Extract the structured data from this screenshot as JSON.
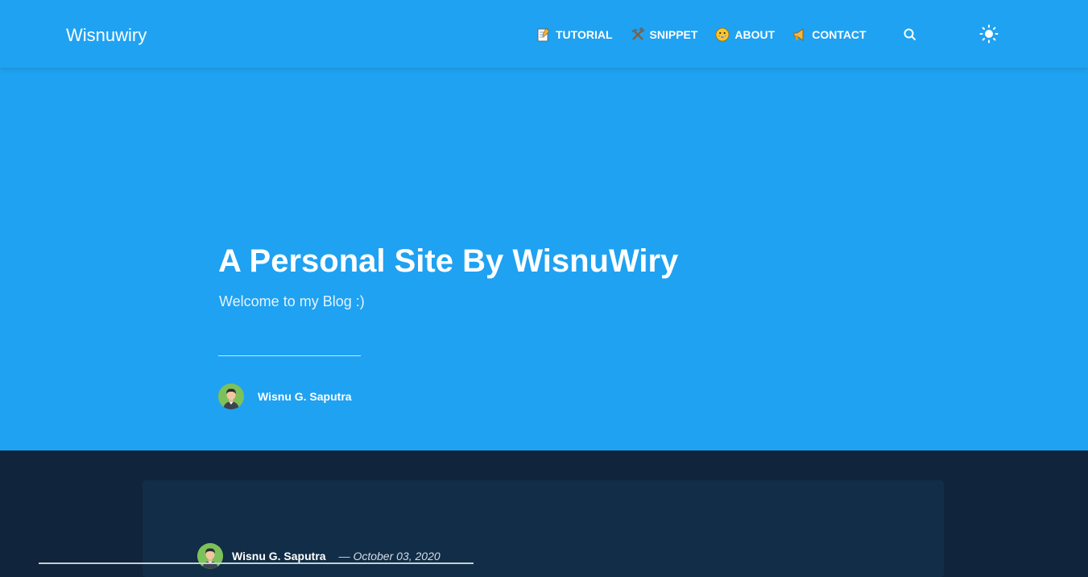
{
  "navbar": {
    "brand": "Wisnuwiry",
    "items": [
      {
        "label": "TUTORIAL",
        "icon": "memo-emoji-icon"
      },
      {
        "label": "SNIPPET",
        "icon": "hammer-and-pick-emoji-icon"
      },
      {
        "label": "ABOUT",
        "icon": "grinning-face-emoji-icon"
      },
      {
        "label": "CONTACT",
        "icon": "loudspeaker-emoji-icon"
      }
    ],
    "search_icon": "search-icon",
    "theme_icon": "sun-icon"
  },
  "hero": {
    "title": "A Personal Site By WisnuWiry",
    "subtitle": "Welcome to my Blog :)",
    "author": "Wisnu G. Saputra"
  },
  "post": {
    "author": "Wisnu G. Saputra",
    "date": "— October 03, 2020"
  },
  "colors": {
    "primary": "#1fa2f2",
    "dark_bg": "#10243b",
    "card_bg": "#112d47",
    "avatar_bg": "#7cc15a"
  }
}
